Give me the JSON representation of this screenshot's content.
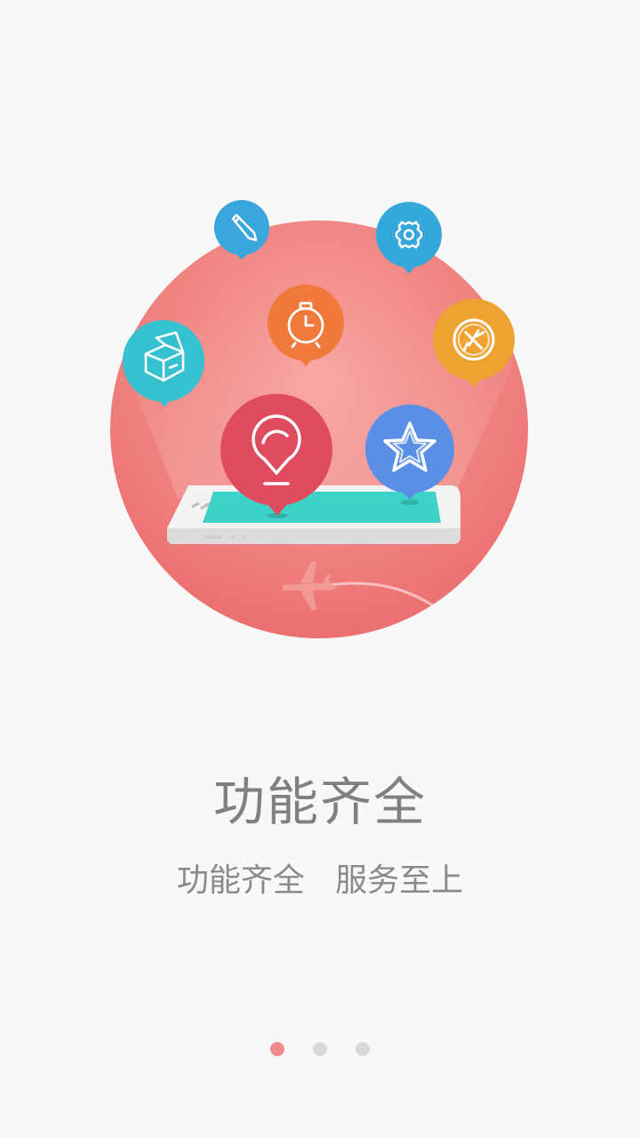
{
  "guide": {
    "title": "功能齐全",
    "subtitle": "功能齐全   服务至上"
  },
  "pager": {
    "total_pages": 3,
    "current_page": 1
  },
  "colors": {
    "background": "#f8f8f8",
    "circle": "#ef7e7e",
    "pin_pencil": "#3aa6de",
    "pin_gear": "#34a8db",
    "pin_stopwatch": "#ef7a3c",
    "pin_box": "#36c1d0",
    "pin_plane": "#eda232",
    "pin_chat": "#df4c5f",
    "pin_star": "#5b8fe6",
    "phone_screen": "#3cd2c8",
    "dot_active": "#ef8a8a",
    "dot_inactive": "#d8d8d8"
  },
  "icons": [
    "pencil-icon",
    "gear-icon",
    "stopwatch-icon",
    "box-icon",
    "airplane-icon",
    "chat-bubble-icon",
    "star-icon"
  ]
}
